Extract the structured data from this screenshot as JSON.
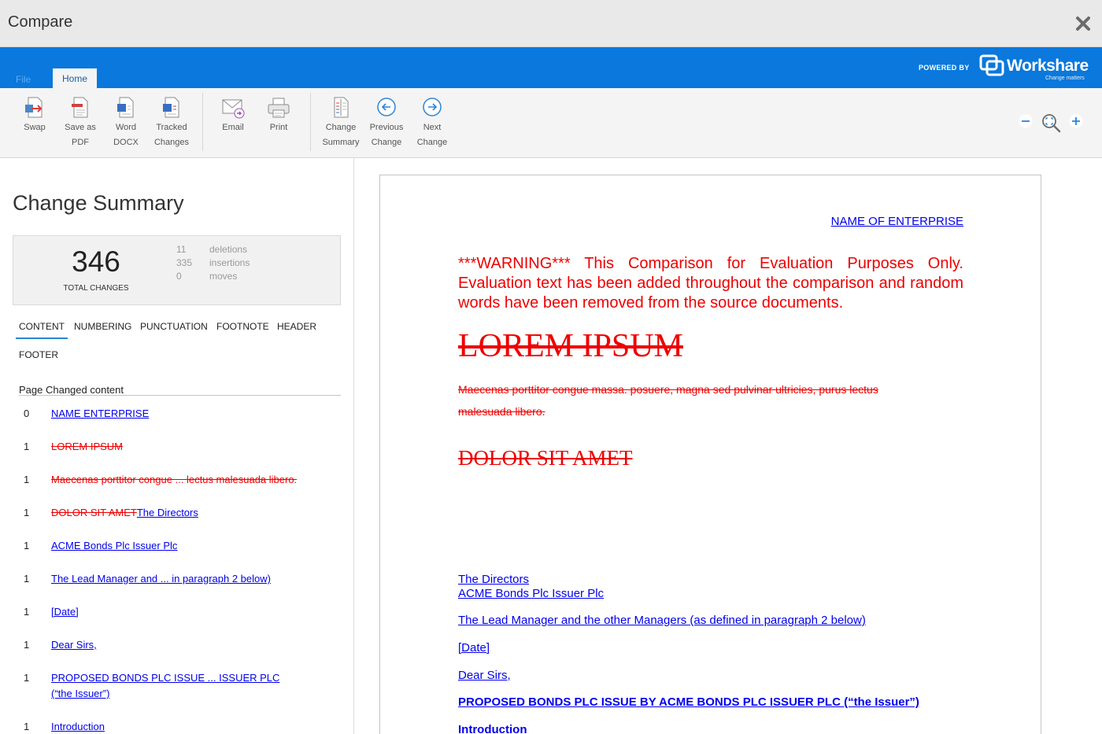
{
  "window": {
    "title": "Compare"
  },
  "brand": {
    "file_tab": "File",
    "home_tab": "Home",
    "powered_by": "POWERED BY",
    "logo_name": "Workshare",
    "logo_tagline": "Change matters",
    "bar_color": "#0a78dc"
  },
  "ribbon": {
    "buttons": [
      {
        "id": "swap",
        "line1": "Swap",
        "line2": ""
      },
      {
        "id": "save-pdf",
        "line1": "Save as",
        "line2": "PDF"
      },
      {
        "id": "word-docx",
        "line1": "Word",
        "line2": "DOCX"
      },
      {
        "id": "tracked",
        "line1": "Tracked",
        "line2": "Changes"
      },
      {
        "id": "email",
        "line1": "Email",
        "line2": ""
      },
      {
        "id": "print",
        "line1": "Print",
        "line2": ""
      },
      {
        "id": "change-summary",
        "line1": "Change",
        "line2": "Summary"
      },
      {
        "id": "previous-change",
        "line1": "Previous",
        "line2": "Change"
      },
      {
        "id": "next-change",
        "line1": "Next",
        "line2": "Change"
      }
    ]
  },
  "summary": {
    "heading": "Change Summary",
    "total": "346",
    "total_label": "TOTAL CHANGES",
    "stats": [
      {
        "count": "11",
        "label": "deletions"
      },
      {
        "count": "335",
        "label": "insertions"
      },
      {
        "count": "0",
        "label": "moves"
      }
    ],
    "tabs": [
      "CONTENT",
      "NUMBERING",
      "PUNCTUATION",
      "FOOTNOTE",
      "HEADER",
      "FOOTER"
    ],
    "list_header": "Page Changed content",
    "items": [
      {
        "page": "0",
        "del": "",
        "ins": "NAME ENTERPRISE"
      },
      {
        "page": "1",
        "del": "LOREM IPSUM",
        "ins": ""
      },
      {
        "page": "1",
        "del": "Maecenas porttitor congue ... lectus malesuada libero.",
        "ins": ""
      },
      {
        "page": "1",
        "del": "DOLOR SIT AMET",
        "ins": "The Directors"
      },
      {
        "page": "1",
        "del": "",
        "ins": "ACME Bonds Plc Issuer Plc"
      },
      {
        "page": "1",
        "del": "",
        "ins": "The Lead Manager and ... in paragraph 2 below)"
      },
      {
        "page": "1",
        "del": "",
        "ins": "[Date]"
      },
      {
        "page": "1",
        "del": "",
        "ins": "Dear Sirs,"
      },
      {
        "page": "1",
        "del": "",
        "ins": "PROPOSED BONDS PLC ISSUE ... ISSUER PLC (“the Issuer”)"
      },
      {
        "page": "1",
        "del": "",
        "ins": "Introduction"
      }
    ],
    "insert_color": "#0000ee",
    "delete_color": "#ee0000"
  },
  "document": {
    "header_right": "NAME OF ENTERPRISE",
    "warning": "***WARNING*** This Comparison for Evaluation Purposes Only. Evaluation text has been added throughout the comparison and random words have been removed from the source documents.",
    "lorem_heading": "LOREM IPSUM",
    "lorem_para_line1": "Maecenas porttitor congue massa. posuere, magna sed pulvinar ultricies, purus lectus",
    "lorem_para_line2": "malesuada libero.",
    "dolor_heading": "DOLOR SIT AMET",
    "directors": "The Directors",
    "issuer": "ACME Bonds Plc Issuer Plc",
    "lead_manager": "The Lead Manager and the other Managers (as defined in paragraph 2 below)",
    "date": "[Date]",
    "dear": "Dear Sirs,",
    "proposed": "PROPOSED BONDS PLC ISSUE BY ACME BONDS PLC ISSUER PLC (“the Issuer”)",
    "introduction": "Introduction"
  }
}
